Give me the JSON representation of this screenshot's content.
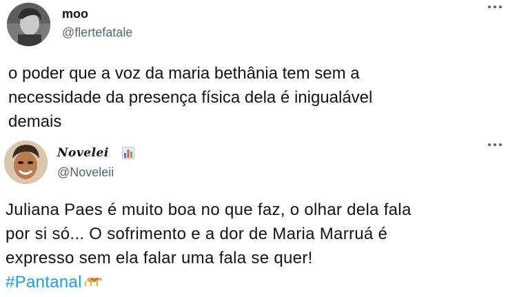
{
  "tweets": [
    {
      "display_name": "moo",
      "handle": "@flertefatale",
      "avatar_icon": "user-avatar-grayscale",
      "text_lines": [
        "o poder que a voz da maria bethânia tem sem a",
        "necessidade da presença física dela é inigualável",
        "demais"
      ]
    },
    {
      "display_name": "Novelei",
      "badge_icon": "bar-chart-emoji",
      "handle": "@Noveleii",
      "avatar_icon": "user-avatar-color",
      "text_lines": [
        "Juliana Paes é muito boa no que faz, o olhar dela fala",
        "por si só... O sofrimento e a dor de Maria Marruá é",
        "expresso sem ela falar uma fala se quer!"
      ],
      "hashtag": "#Pantanal",
      "hashtag_emoji_icon": "leopard-emoji"
    }
  ],
  "colors": {
    "text": "#0f1419",
    "secondary": "#536471",
    "link": "#1d9bf0"
  }
}
